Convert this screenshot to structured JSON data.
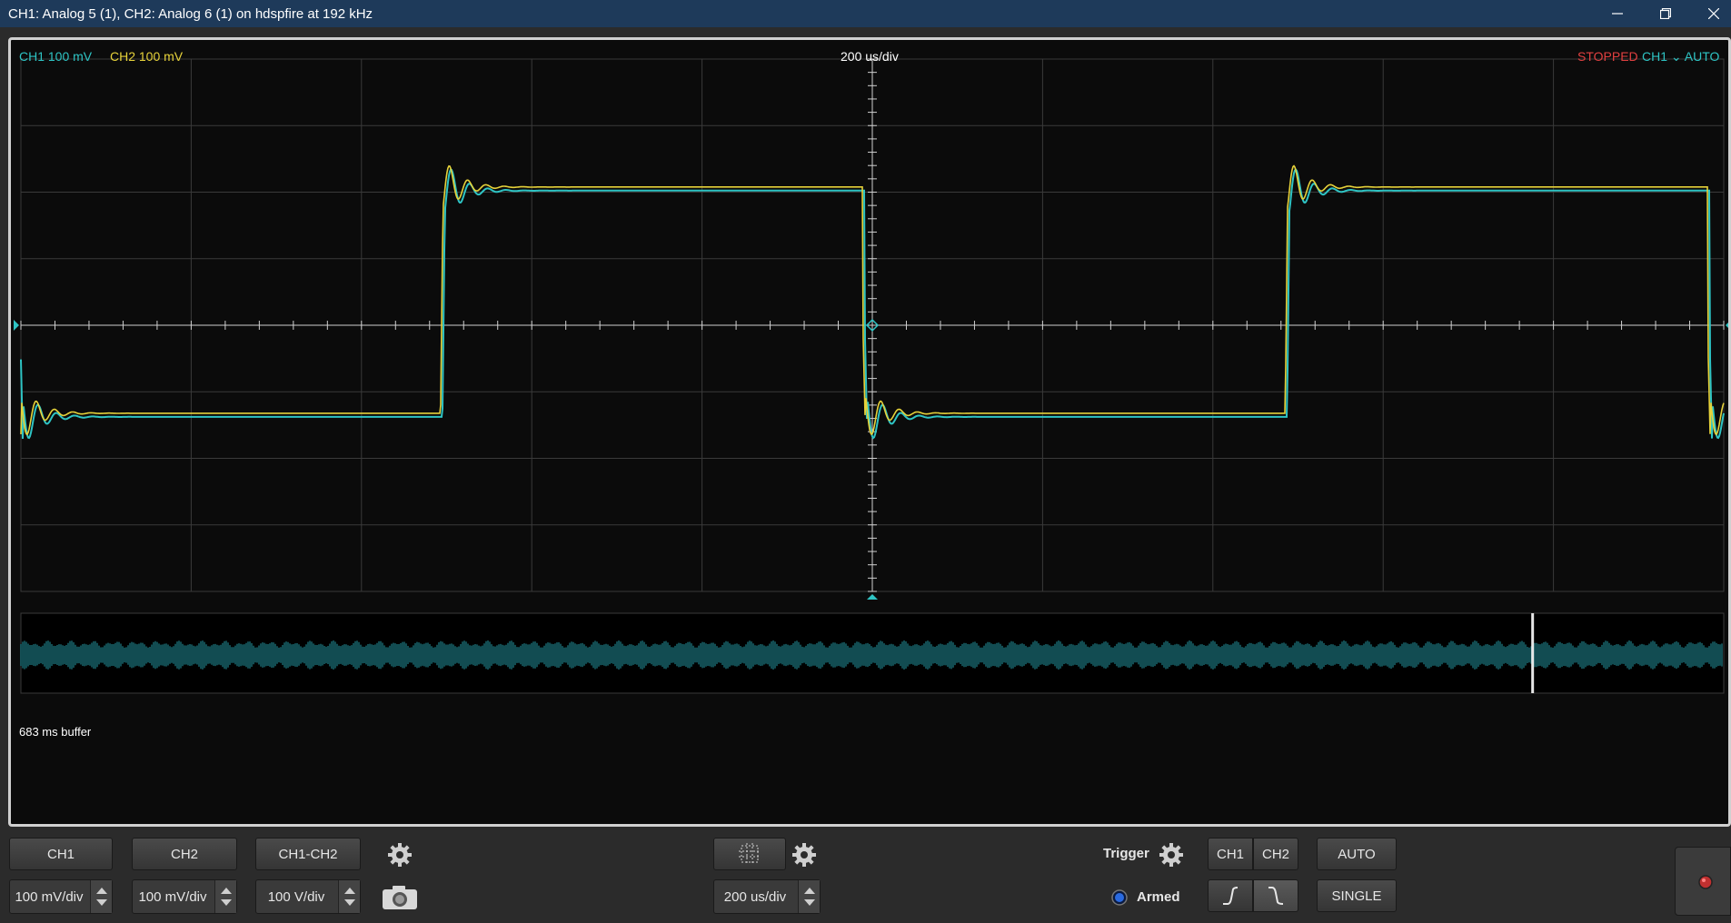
{
  "window": {
    "title": "CH1: Analog 5 (1), CH2: Analog 6 (1) on hdspfire at 192 kHz",
    "minimize_icon": "minimize-icon",
    "maximize_icon": "restore-icon",
    "close_icon": "close-icon"
  },
  "scope": {
    "ch1_label": "CH1 100 mV",
    "ch2_label": "CH2 100 mV",
    "timebase_label": "200 us/div",
    "status": "STOPPED",
    "trigger_source": "CH1",
    "trigger_slope_glyph": "⌄",
    "trigger_mode": "AUTO",
    "buffer_label": "683 ms buffer",
    "colors": {
      "ch1": "#2ec4c4",
      "ch2": "#e6d23a",
      "status": "#e04040",
      "grid": "#3a3a3a",
      "axis": "#cfcfcf",
      "background": "#0b0b0b"
    }
  },
  "controls": {
    "ch1_button": "CH1",
    "ch2_button": "CH2",
    "math_button": "CH1-CH2",
    "ch1_scale": "100 mV/div",
    "ch2_scale": "100 mV/div",
    "math_scale": "100 V/div",
    "timebase_value": "200 us/div",
    "trigger_label": "Trigger",
    "armed_label": "Armed",
    "trig_ch1": "CH1",
    "trig_ch2": "CH2",
    "auto_button": "AUTO",
    "single_button": "SINGLE",
    "icons": [
      "settings-gear-icon",
      "camera-icon",
      "grid-toggle-icon",
      "rising-edge-icon",
      "falling-edge-icon",
      "record-icon",
      "armed-led-icon"
    ]
  }
}
